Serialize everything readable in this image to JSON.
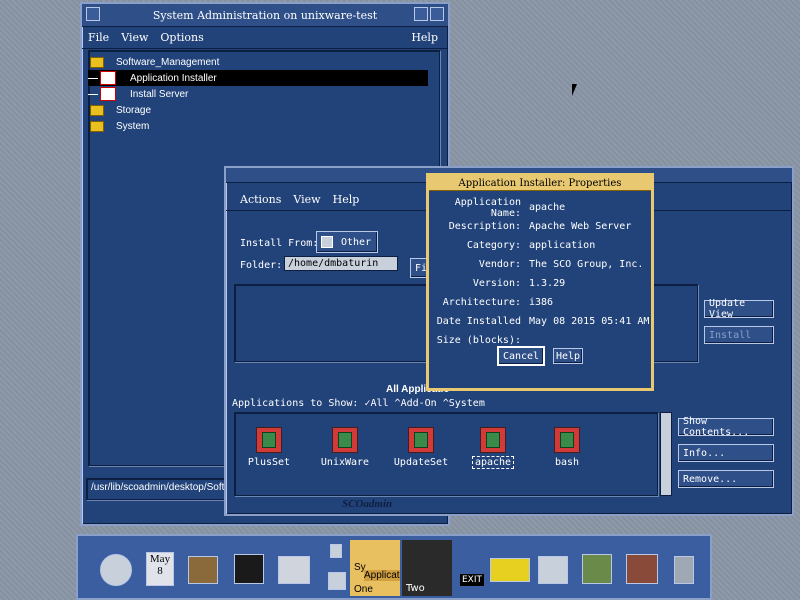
{
  "sysadmin": {
    "title": "System Administration on unixware-test",
    "menu": [
      "File",
      "View",
      "Options"
    ],
    "help": "Help",
    "tree": [
      {
        "label": "Software_Management"
      },
      {
        "label": "Application Installer"
      },
      {
        "label": "Install Server"
      },
      {
        "label": "Storage"
      },
      {
        "label": "System"
      }
    ],
    "status_path": "/usr/lib/scoadmin/desktop/Soft"
  },
  "installer": {
    "menu": [
      "Actions",
      "View",
      "Help"
    ],
    "install_from_label": "Install From:",
    "install_from_value": "Other",
    "folder_label": "Folder:",
    "folder_value": "/home/dmbaturin",
    "find_button": "Fi",
    "update_view": "Update View",
    "install": "Install",
    "all_apps_heading": "All Applicatio",
    "apps_to_show_label": "Applications to Show:",
    "filters": [
      "All",
      "Add-On",
      "System"
    ],
    "apps": [
      "PlusSet",
      "UnixWare",
      "UpdateSet",
      "apache",
      "bash"
    ],
    "show_contents": "Show Contents...",
    "info": "Info...",
    "remove": "Remove...",
    "corner_text": "SCOadmin"
  },
  "properties": {
    "title": "Application Installer: Properties",
    "rows": [
      {
        "label": "Application Name:",
        "value": "apache"
      },
      {
        "label": "Description:",
        "value": "Apache Web Server"
      },
      {
        "label": "Category:",
        "value": "application"
      },
      {
        "label": "Vendor:",
        "value": "The SCO Group, Inc."
      },
      {
        "label": "Version:",
        "value": "1.3.29"
      },
      {
        "label": "Architecture:",
        "value": "i386"
      },
      {
        "label": "Date Installed",
        "value": "May 08 2015 05:41 AM"
      },
      {
        "label": "Size (blocks):",
        "value": ""
      }
    ],
    "cancel": "Cancel",
    "help": "Help"
  },
  "dock": {
    "calendar_month": "May",
    "calendar_day": "8",
    "workspace_one_labels": [
      "Sy",
      "Applicat",
      "One"
    ],
    "workspace_two": "Two",
    "exit": "EXIT"
  },
  "colors": {
    "window_bg": "#22437a",
    "selection": "#000000",
    "dialog_border": "#e8c870",
    "desktop": "#8a96a6"
  }
}
